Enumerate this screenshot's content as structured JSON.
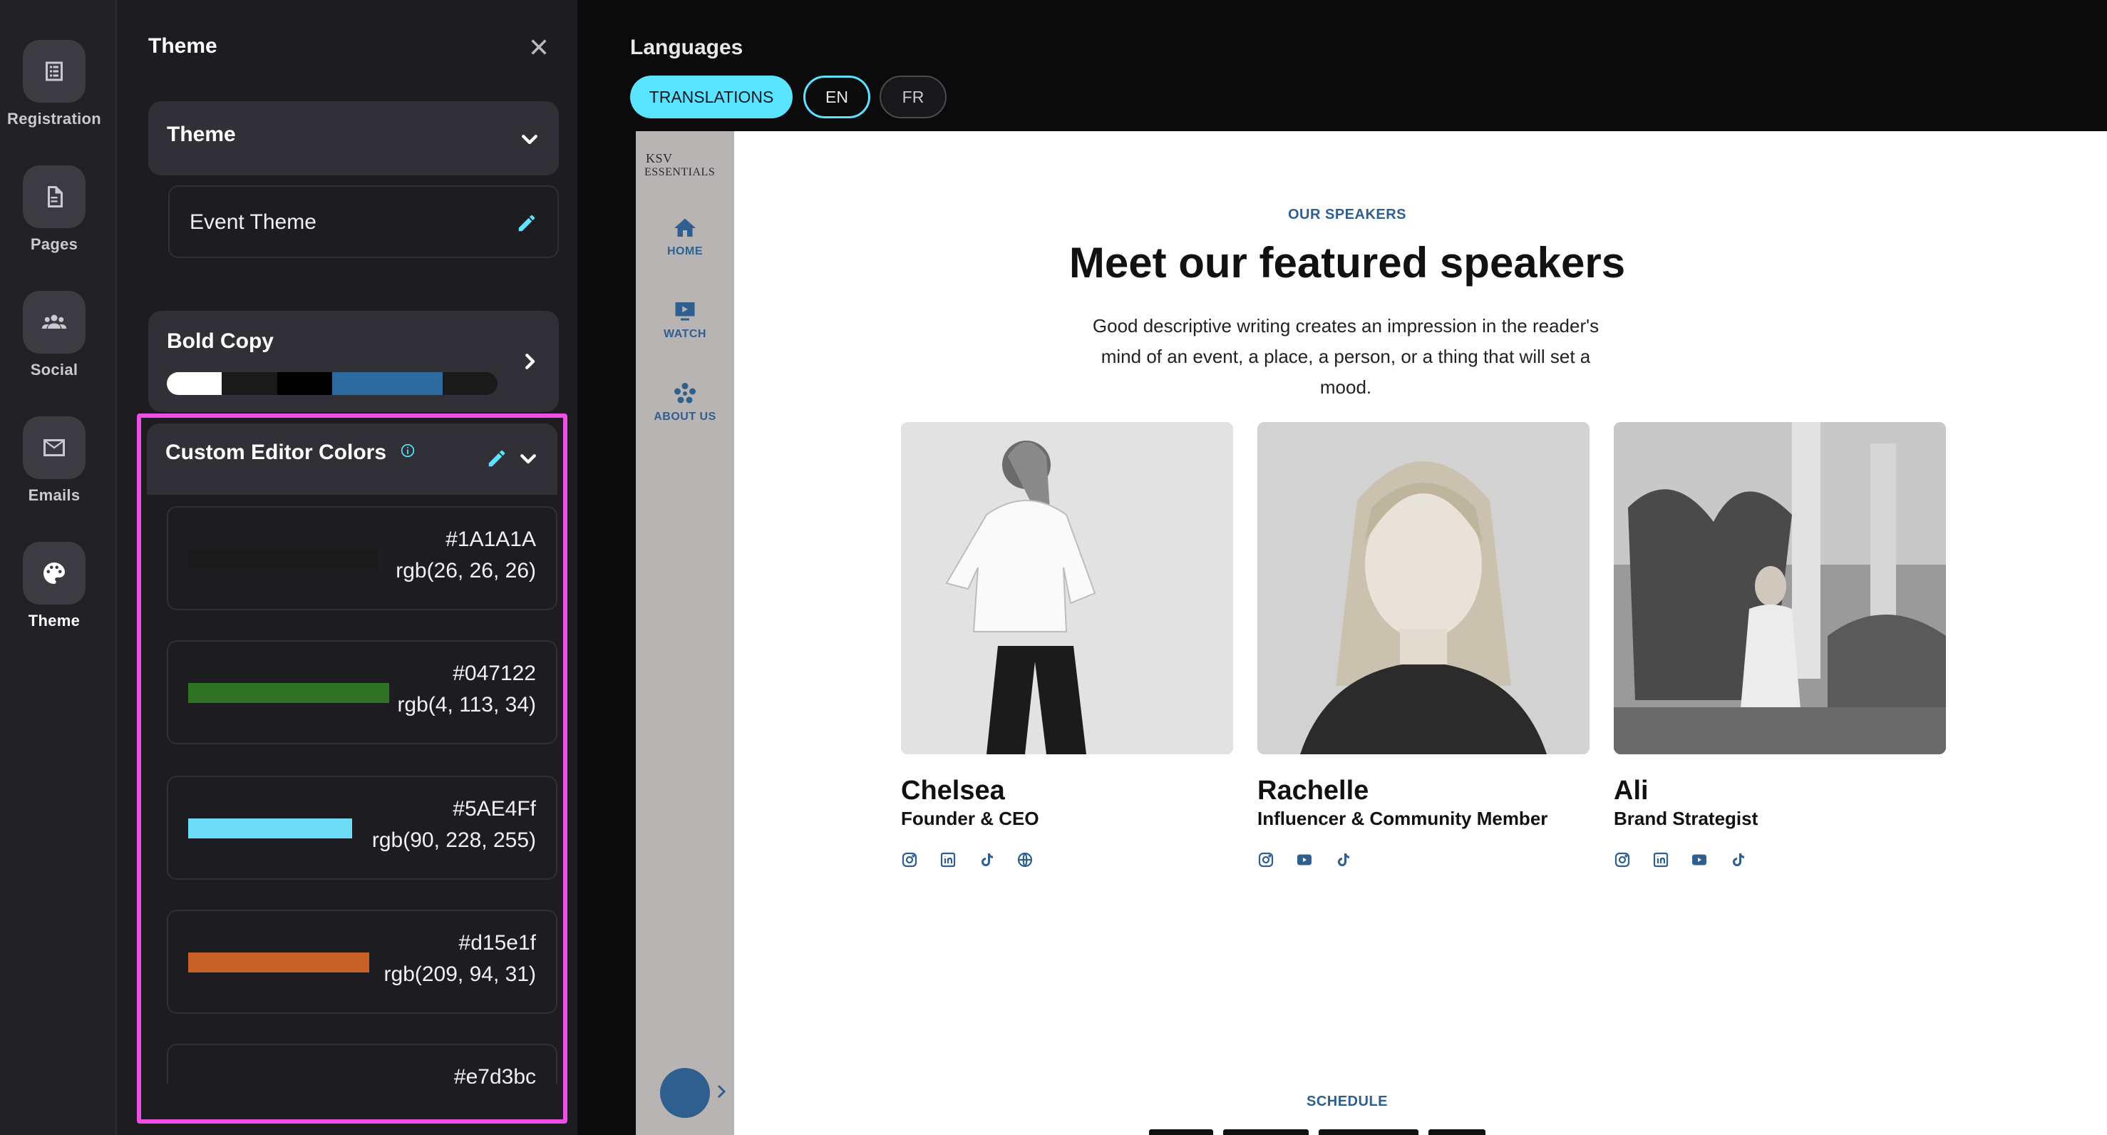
{
  "rail": {
    "items": [
      {
        "label": "Registration",
        "icon": "registration-icon"
      },
      {
        "label": "Pages",
        "icon": "pages-icon"
      },
      {
        "label": "Social",
        "icon": "social-icon"
      },
      {
        "label": "Emails",
        "icon": "emails-icon"
      },
      {
        "label": "Theme",
        "icon": "palette-icon",
        "active": true
      }
    ]
  },
  "panel": {
    "title": "Theme",
    "theme_section": {
      "title": "Theme",
      "value": "Event Theme"
    },
    "bold_copy": {
      "title": "Bold Copy",
      "colors": [
        "#ffffff",
        "#1a1a1a",
        "#000000",
        "#2c6aa0",
        "#2c6aa0",
        "#1a1a1a"
      ]
    },
    "custom_colors": {
      "title": "Custom Editor Colors",
      "items": [
        {
          "hex": "#1A1A1A",
          "rgb": "rgb(26, 26, 26)",
          "color": "#1a1a1a"
        },
        {
          "hex": "#047122",
          "rgb": "rgb(4, 113, 34)",
          "color": "#2e7123"
        },
        {
          "hex": "#5AE4Ff",
          "rgb": "rgb(90, 228, 255)",
          "color": "#6ddcf6"
        },
        {
          "hex": "#d15e1f",
          "rgb": "rgb(209, 94, 31)",
          "color": "#c86128"
        },
        {
          "hex": "#e7d3bc",
          "rgb": "",
          "color": "#e7d3bc"
        }
      ]
    }
  },
  "languages": {
    "title": "Languages",
    "translations_label": "TRANSLATIONS",
    "options": [
      "EN",
      "FR"
    ],
    "selected": "EN"
  },
  "preview": {
    "logo_line1": "KSV",
    "logo_line2": "ESSENTIALS",
    "nav": [
      {
        "label": "HOME",
        "icon": "home-icon"
      },
      {
        "label": "WATCH",
        "icon": "play-icon"
      },
      {
        "label": "ABOUT US",
        "icon": "group-icon"
      }
    ],
    "eyebrow": "OUR SPEAKERS",
    "headline": "Meet our featured speakers",
    "description": "Good descriptive writing creates an impression in the reader's mind of an event, a place, a person, or a thing that will set a mood.",
    "speakers": [
      {
        "name": "Chelsea",
        "role": "Founder & CEO",
        "socials": [
          "instagram",
          "linkedin",
          "tiktok",
          "website"
        ]
      },
      {
        "name": "Rachelle",
        "role": "Influencer & Community Member",
        "socials": [
          "instagram",
          "youtube",
          "tiktok"
        ]
      },
      {
        "name": "Ali",
        "role": "Brand Strategist",
        "socials": [
          "instagram",
          "linkedin",
          "youtube",
          "tiktok"
        ]
      }
    ],
    "next_eyebrow": "SCHEDULE"
  }
}
